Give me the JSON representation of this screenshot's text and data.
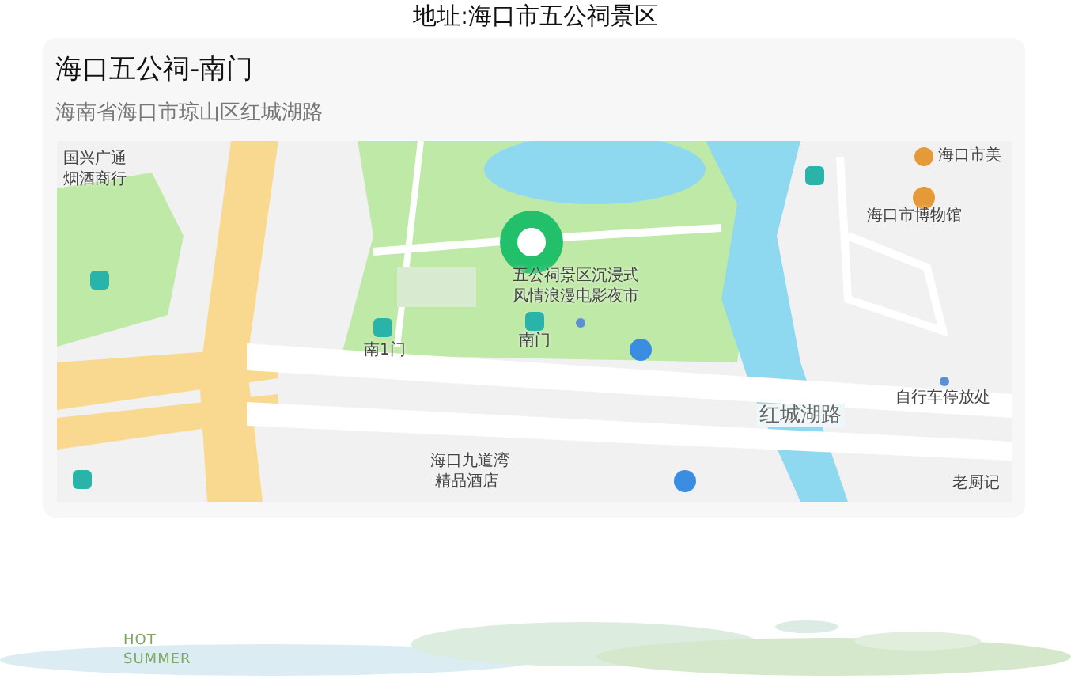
{
  "page_title": "地址:海口市五公祠景区",
  "location": {
    "name": "海口五公祠-南门",
    "address": "海南省海口市琼山区红城湖路"
  },
  "map": {
    "labels": [
      {
        "text": "国兴广通",
        "kind": "poi"
      },
      {
        "text": "烟酒商行",
        "kind": "poi"
      },
      {
        "text": "海口市美",
        "kind": "poi"
      },
      {
        "text": "海口市博物馆",
        "kind": "poi"
      },
      {
        "text": "五公祠景区沉浸式",
        "kind": "poi"
      },
      {
        "text": "风情浪漫电影夜市",
        "kind": "poi"
      },
      {
        "text": "南门",
        "kind": "poi"
      },
      {
        "text": "南1门",
        "kind": "poi"
      },
      {
        "text": "红城湖路",
        "kind": "road"
      },
      {
        "text": "自行车停放处",
        "kind": "poi"
      },
      {
        "text": "海口九道湾",
        "kind": "poi"
      },
      {
        "text": "精品酒店",
        "kind": "poi"
      },
      {
        "text": "老厨记",
        "kind": "poi"
      }
    ]
  },
  "footer": {
    "brand_lines": [
      "HOT",
      "SUMMER"
    ]
  }
}
